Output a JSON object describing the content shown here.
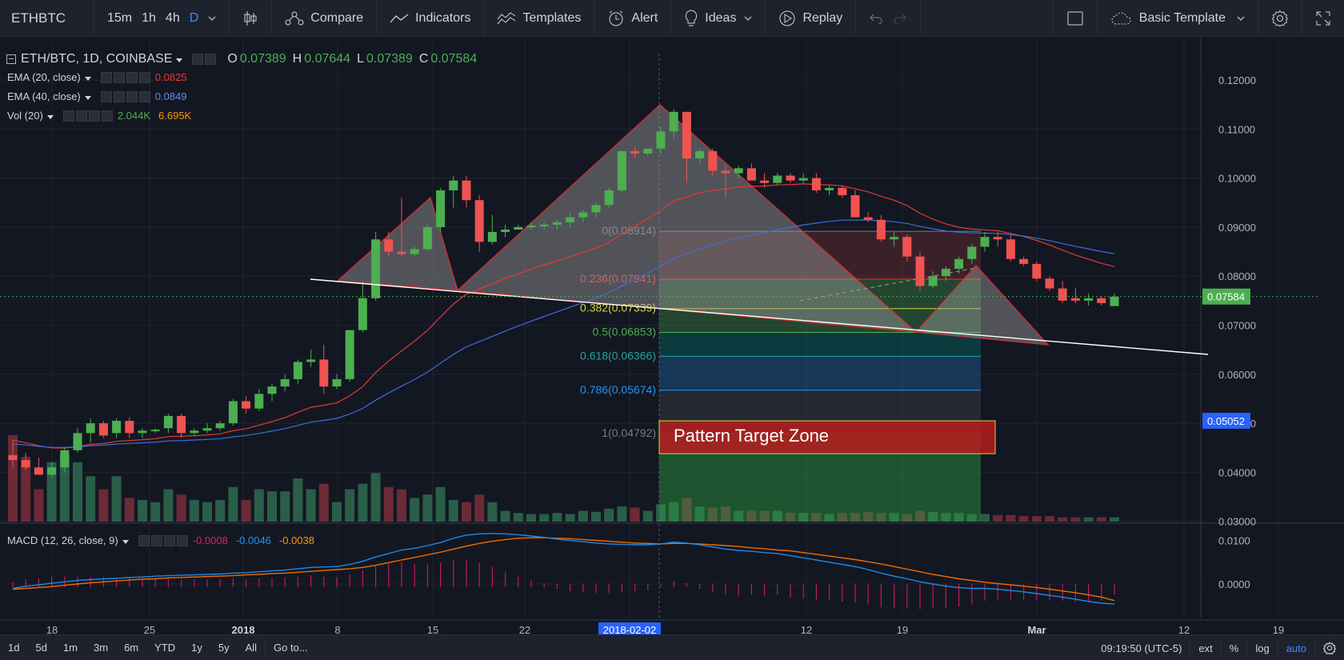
{
  "toolbar": {
    "symbol": "ETHBTC",
    "intervals": [
      "15m",
      "1h",
      "4h",
      "D"
    ],
    "active_interval": "D",
    "compare": "Compare",
    "indicators": "Indicators",
    "templates": "Templates",
    "alert": "Alert",
    "ideas": "Ideas",
    "replay": "Replay",
    "template_name": "Basic Template"
  },
  "legend": {
    "title": "ETH/BTC, 1D, COINBASE",
    "o_label": "O",
    "o_value": "0.07389",
    "h_label": "H",
    "h_value": "0.07644",
    "l_label": "L",
    "l_value": "0.07389",
    "c_label": "C",
    "c_value": "0.07584",
    "ema20_label": "EMA (20, close)",
    "ema20_value": "0.0825",
    "ema40_label": "EMA (40, close)",
    "ema40_value": "0.0849",
    "vol_label": "Vol (20)",
    "vol_value1": "2.044K",
    "vol_value2": "6.695K",
    "macd_label": "MACD (12, 26, close, 9)",
    "macd_v1": "-0.0008",
    "macd_v2": "-0.0046",
    "macd_v3": "-0.0038"
  },
  "colors": {
    "up": "#4caf50",
    "down": "#ef5350",
    "ema20": "#e53935",
    "ema40": "#3b6fd9",
    "macd": "#1e88e5",
    "signal": "#ef6c00",
    "pattern_fill": "#9e9e9e",
    "pattern_stroke": "#d32f2f"
  },
  "chart_data": {
    "type": "candlestick",
    "price_axis": [
      "0.12000",
      "0.11000",
      "0.10000",
      "0.09000",
      "0.08000",
      "0.07000",
      "0.06000",
      "0.05000",
      "0.04000",
      "0.03000"
    ],
    "current_price": "0.07584",
    "crosshair_price": "0.05052",
    "macd_axis": [
      "0.0100",
      "0.0000"
    ],
    "time_axis": [
      "18",
      "25",
      "2018",
      "8",
      "15",
      "22",
      "2018-02-02",
      "12",
      "19",
      "Mar",
      "12",
      "19"
    ],
    "fib_levels": [
      {
        "label": "0(0.08914)",
        "value": 0.08914
      },
      {
        "label": "0.236(0.07941)",
        "value": 0.07941
      },
      {
        "label": "0.382(0.07339)",
        "value": 0.07339
      },
      {
        "label": "0.5(0.06853)",
        "value": 0.06853
      },
      {
        "label": "0.618(0.06366)",
        "value": 0.06366
      },
      {
        "label": "0.786(0.05674)",
        "value": 0.05674
      },
      {
        "label": "1(0.04792)",
        "value": 0.04792
      }
    ],
    "annotation": "Pattern Target Zone",
    "candles": [
      [
        0.0435,
        0.0465,
        0.041,
        0.0425
      ],
      [
        0.0425,
        0.044,
        0.0405,
        0.041
      ],
      [
        0.041,
        0.043,
        0.04,
        0.0395
      ],
      [
        0.0395,
        0.042,
        0.039,
        0.041
      ],
      [
        0.041,
        0.045,
        0.04,
        0.0445
      ],
      [
        0.0445,
        0.049,
        0.044,
        0.048
      ],
      [
        0.048,
        0.051,
        0.046,
        0.05
      ],
      [
        0.05,
        0.0505,
        0.047,
        0.0475
      ],
      [
        0.048,
        0.051,
        0.047,
        0.0505
      ],
      [
        0.0505,
        0.0512,
        0.047,
        0.048
      ],
      [
        0.048,
        0.049,
        0.047,
        0.0485
      ],
      [
        0.0485,
        0.049,
        0.048,
        0.0487
      ],
      [
        0.049,
        0.052,
        0.048,
        0.0515
      ],
      [
        0.0515,
        0.052,
        0.047,
        0.048
      ],
      [
        0.048,
        0.049,
        0.0475,
        0.0485
      ],
      [
        0.0485,
        0.05,
        0.048,
        0.049
      ],
      [
        0.049,
        0.0505,
        0.0485,
        0.05
      ],
      [
        0.05,
        0.055,
        0.0495,
        0.0545
      ],
      [
        0.0545,
        0.0555,
        0.052,
        0.053
      ],
      [
        0.053,
        0.057,
        0.0525,
        0.056
      ],
      [
        0.056,
        0.058,
        0.0545,
        0.0575
      ],
      [
        0.0575,
        0.06,
        0.0565,
        0.059
      ],
      [
        0.059,
        0.063,
        0.058,
        0.0625
      ],
      [
        0.0625,
        0.065,
        0.0615,
        0.063
      ],
      [
        0.063,
        0.066,
        0.056,
        0.0575
      ],
      [
        0.0575,
        0.06,
        0.057,
        0.059
      ],
      [
        0.059,
        0.069,
        0.0585,
        0.069
      ],
      [
        0.069,
        0.079,
        0.0685,
        0.0755
      ],
      [
        0.0755,
        0.089,
        0.075,
        0.0875
      ],
      [
        0.0875,
        0.089,
        0.084,
        0.085
      ],
      [
        0.085,
        0.096,
        0.084,
        0.0845
      ],
      [
        0.0845,
        0.086,
        0.084,
        0.0855
      ],
      [
        0.0855,
        0.0905,
        0.085,
        0.09
      ],
      [
        0.09,
        0.098,
        0.089,
        0.0975
      ],
      [
        0.0975,
        0.1005,
        0.094,
        0.0995
      ],
      [
        0.0995,
        0.1005,
        0.094,
        0.0955
      ],
      [
        0.0955,
        0.0965,
        0.085,
        0.087
      ],
      [
        0.087,
        0.0925,
        0.0865,
        0.089
      ],
      [
        0.089,
        0.0905,
        0.088,
        0.0895
      ],
      [
        0.0895,
        0.0905,
        0.0895,
        0.09
      ],
      [
        0.09,
        0.091,
        0.0895,
        0.0903
      ],
      [
        0.0903,
        0.091,
        0.0895,
        0.0905
      ],
      [
        0.0905,
        0.0915,
        0.0895,
        0.091
      ],
      [
        0.091,
        0.093,
        0.09,
        0.092
      ],
      [
        0.092,
        0.0935,
        0.091,
        0.093
      ],
      [
        0.093,
        0.095,
        0.092,
        0.0945
      ],
      [
        0.0945,
        0.098,
        0.094,
        0.0975
      ],
      [
        0.0975,
        0.101,
        0.097,
        0.1055
      ],
      [
        0.1055,
        0.1065,
        0.104,
        0.105
      ],
      [
        0.105,
        0.106,
        0.1045,
        0.106
      ],
      [
        0.106,
        0.1105,
        0.105,
        0.1095
      ],
      [
        0.1095,
        0.114,
        0.108,
        0.1135
      ],
      [
        0.1135,
        0.1135,
        0.099,
        0.104
      ],
      [
        0.104,
        0.106,
        0.103,
        0.1055
      ],
      [
        0.1055,
        0.106,
        0.1005,
        0.1015
      ],
      [
        0.1015,
        0.1025,
        0.096,
        0.101
      ],
      [
        0.101,
        0.1025,
        0.1,
        0.102
      ],
      [
        0.102,
        0.103,
        0.1,
        0.0995
      ],
      [
        0.0995,
        0.101,
        0.098,
        0.099
      ],
      [
        0.099,
        0.101,
        0.0985,
        0.1005
      ],
      [
        0.1005,
        0.101,
        0.099,
        0.0995
      ],
      [
        0.0995,
        0.101,
        0.099,
        0.1
      ],
      [
        0.1,
        0.101,
        0.097,
        0.0975
      ],
      [
        0.0975,
        0.0985,
        0.0965,
        0.098
      ],
      [
        0.098,
        0.0985,
        0.096,
        0.0965
      ],
      [
        0.0965,
        0.0975,
        0.092,
        0.092
      ],
      [
        0.092,
        0.093,
        0.091,
        0.0915
      ],
      [
        0.0915,
        0.0925,
        0.087,
        0.0875
      ],
      [
        0.0875,
        0.089,
        0.086,
        0.088
      ],
      [
        0.088,
        0.0885,
        0.083,
        0.084
      ],
      [
        0.084,
        0.085,
        0.077,
        0.078
      ],
      [
        0.078,
        0.081,
        0.0775,
        0.08
      ],
      [
        0.08,
        0.082,
        0.079,
        0.0815
      ],
      [
        0.0815,
        0.084,
        0.0805,
        0.0835
      ],
      [
        0.0835,
        0.0865,
        0.0825,
        0.086
      ],
      [
        0.086,
        0.089,
        0.085,
        0.088
      ],
      [
        0.088,
        0.089,
        0.086,
        0.0875
      ],
      [
        0.0875,
        0.0885,
        0.083,
        0.0835
      ],
      [
        0.0835,
        0.084,
        0.082,
        0.0825
      ],
      [
        0.0825,
        0.083,
        0.079,
        0.0795
      ],
      [
        0.0795,
        0.08,
        0.077,
        0.0775
      ],
      [
        0.0775,
        0.079,
        0.0745,
        0.075
      ],
      [
        0.0755,
        0.0775,
        0.0745,
        0.075
      ],
      [
        0.075,
        0.0765,
        0.074,
        0.0755
      ],
      [
        0.0755,
        0.076,
        0.074,
        0.0745
      ],
      [
        0.0739,
        0.0764,
        0.0739,
        0.0758
      ]
    ],
    "volume": [
      0.8,
      0.6,
      0.3,
      0.55,
      0.62,
      0.55,
      0.42,
      0.3,
      0.42,
      0.22,
      0.2,
      0.18,
      0.3,
      0.25,
      0.2,
      0.18,
      0.2,
      0.32,
      0.2,
      0.3,
      0.28,
      0.28,
      0.4,
      0.3,
      0.35,
      0.18,
      0.3,
      0.35,
      0.45,
      0.32,
      0.3,
      0.22,
      0.25,
      0.32,
      0.2,
      0.18,
      0.25,
      0.18,
      0.1,
      0.08,
      0.07,
      0.07,
      0.08,
      0.07,
      0.1,
      0.09,
      0.12,
      0.14,
      0.13,
      0.1,
      0.16,
      0.18,
      0.22,
      0.14,
      0.13,
      0.14,
      0.1,
      0.1,
      0.1,
      0.1,
      0.08,
      0.08,
      0.08,
      0.07,
      0.08,
      0.08,
      0.09,
      0.08,
      0.08,
      0.07,
      0.1,
      0.09,
      0.08,
      0.08,
      0.07,
      0.07,
      0.06,
      0.06,
      0.05,
      0.05,
      0.05,
      0.04,
      0.04,
      0.04,
      0.04,
      0.04
    ],
    "macd": [
      -0.001,
      -0.0005,
      -0.0002,
      0.0002,
      0.0005,
      0.0008,
      0.001,
      0.0012,
      0.0013,
      0.0015,
      0.0016,
      0.0018,
      0.0019,
      0.002,
      0.0021,
      0.0022,
      0.0023,
      0.0025,
      0.0026,
      0.0028,
      0.003,
      0.0032,
      0.0035,
      0.0038,
      0.0039,
      0.004,
      0.0045,
      0.0052,
      0.0062,
      0.007,
      0.0078,
      0.0082,
      0.0088,
      0.0095,
      0.0105,
      0.0112,
      0.0115,
      0.0116,
      0.0115,
      0.0113,
      0.011,
      0.0107,
      0.0103,
      0.01,
      0.0097,
      0.0094,
      0.0092,
      0.0091,
      0.009,
      0.009,
      0.0092,
      0.0096,
      0.0094,
      0.009,
      0.0085,
      0.008,
      0.0077,
      0.0075,
      0.0072,
      0.007,
      0.0065,
      0.006,
      0.0055,
      0.005,
      0.0045,
      0.004,
      0.0033,
      0.0025,
      0.0018,
      0.0012,
      0.0005,
      0.0,
      -0.0005,
      -0.0008,
      -0.001,
      -0.001,
      -0.0012,
      -0.0015,
      -0.0018,
      -0.0022,
      -0.0026,
      -0.003,
      -0.0035,
      -0.004,
      -0.0044,
      -0.0046
    ],
    "signal": [
      -0.0012,
      -0.001,
      -0.0008,
      -0.0006,
      -0.0003,
      0.0,
      0.0003,
      0.0005,
      0.0007,
      0.0009,
      0.0011,
      0.0012,
      0.0014,
      0.0015,
      0.0016,
      0.0017,
      0.0018,
      0.0019,
      0.0021,
      0.0022,
      0.0024,
      0.0025,
      0.0027,
      0.0029,
      0.0031,
      0.0033,
      0.0035,
      0.0038,
      0.0043,
      0.0049,
      0.0055,
      0.0061,
      0.0067,
      0.0073,
      0.008,
      0.0087,
      0.0093,
      0.0098,
      0.0102,
      0.0105,
      0.0106,
      0.0106,
      0.0105,
      0.0104,
      0.0102,
      0.01,
      0.0098,
      0.0096,
      0.0094,
      0.0093,
      0.0092,
      0.0093,
      0.0093,
      0.0092,
      0.009,
      0.0088,
      0.0086,
      0.0083,
      0.0081,
      0.0078,
      0.0076,
      0.0072,
      0.0068,
      0.0064,
      0.006,
      0.0056,
      0.0051,
      0.0046,
      0.004,
      0.0034,
      0.0028,
      0.0022,
      0.0017,
      0.0012,
      0.0008,
      0.0004,
      0.0001,
      -0.0002,
      -0.0005,
      -0.0008,
      -0.0012,
      -0.0016,
      -0.002,
      -0.0025,
      -0.003,
      -0.0038
    ]
  },
  "bottombar": {
    "ranges": [
      "1d",
      "5d",
      "1m",
      "3m",
      "6m",
      "YTD",
      "1y",
      "5y",
      "All"
    ],
    "goto": "Go to...",
    "clock": "09:19:50 (UTC-5)",
    "ext": "ext",
    "pct": "%",
    "log": "log",
    "auto": "auto"
  }
}
